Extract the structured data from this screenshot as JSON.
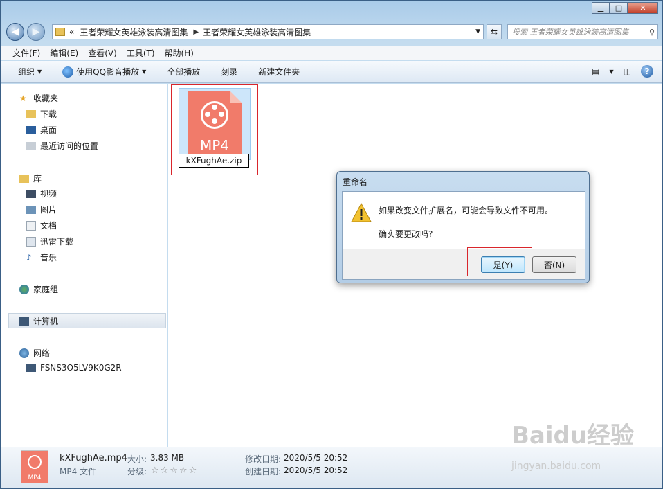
{
  "window": {
    "controls": {
      "minimize": "▁",
      "maximize": "□",
      "close": "✕"
    }
  },
  "address": {
    "back_icon": "back-arrow-icon",
    "forward_icon": "forward-arrow-icon",
    "prefix": "«",
    "segments": [
      "王者荣耀女英雄泳装高清图集",
      "王者荣耀女英雄泳装高清图集"
    ],
    "search_placeholder": "搜索 王者荣耀女英雄泳装高清图集"
  },
  "menubar": {
    "items": [
      "文件(F)",
      "编辑(E)",
      "查看(V)",
      "工具(T)",
      "帮助(H)"
    ]
  },
  "toolbar": {
    "organize": "组织",
    "play_with_qq": "使用QQ影音播放",
    "play_all": "全部播放",
    "burn": "刻录",
    "new_folder": "新建文件夹",
    "help": "?"
  },
  "sidebar": {
    "favorites": "收藏夹",
    "fav_items": [
      "下载",
      "桌面",
      "最近访问的位置"
    ],
    "library": "库",
    "lib_items": [
      "视频",
      "图片",
      "文档",
      "迅雷下载",
      "音乐"
    ],
    "homegroup": "家庭组",
    "computer": "计算机",
    "network": "网络",
    "net_items": [
      "FSNS3O5LV9K0G2R"
    ]
  },
  "file": {
    "icon_label": "MP4",
    "rename_value": "kXFughAe.zip"
  },
  "dialog": {
    "title": "重命名",
    "message1": "如果改变文件扩展名，可能会导致文件不可用。",
    "message2": "确实要更改吗?",
    "yes": "是(Y)",
    "no": "否(N)"
  },
  "status": {
    "icon_label": "MP4",
    "filename": "kXFughAe.mp4",
    "type": "MP4 文件",
    "size_label": "大小:",
    "size": "3.83 MB",
    "rating_label": "分级:",
    "rating_stars": "☆☆☆☆☆",
    "modified_label": "修改日期:",
    "modified": "2020/5/5 20:52",
    "created_label": "创建日期:",
    "created": "2020/5/5 20:52"
  },
  "watermark": {
    "brand": "Baidu经验",
    "url": "jingyan.baidu.com"
  }
}
